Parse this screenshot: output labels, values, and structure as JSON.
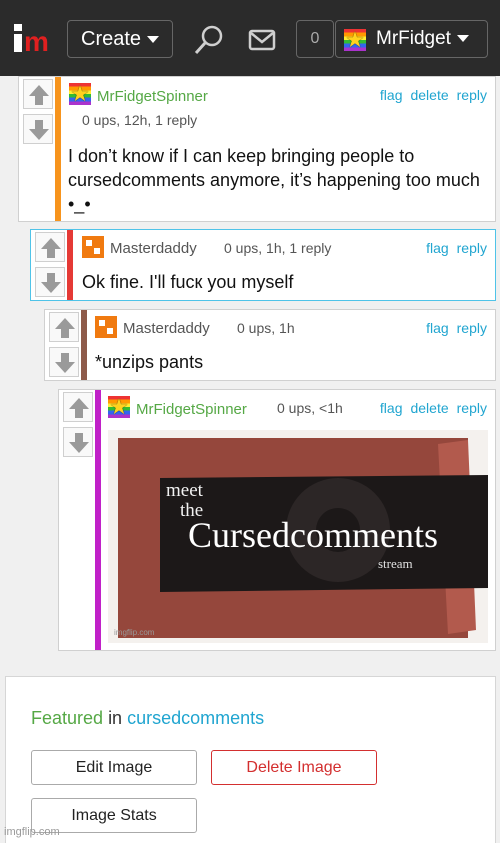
{
  "topbar": {
    "create_label": "Create",
    "notification_count": "0",
    "username": "MrFidget"
  },
  "comments": [
    {
      "username": "MrFidgetSpinner",
      "meta": "0 ups, 12h, 1 reply",
      "actions": [
        "flag",
        "delete",
        "reply"
      ],
      "text": "I don’t know if I can keep bringing people to cursedcomments anymore, it’s happening too much •_•",
      "bar_color": "#f7941d"
    },
    {
      "username": "Masterdaddy",
      "meta": "0 ups, 1h, 1 reply",
      "actions": [
        "flag",
        "reply"
      ],
      "text": "Ok fine. I'll fucк you myself",
      "bar_color": "#e53935"
    },
    {
      "username": "Masterdaddy",
      "meta": "0 ups, 1h",
      "actions": [
        "flag",
        "reply"
      ],
      "text": "*unzips pants",
      "bar_color": "#8d5a4a"
    },
    {
      "username": "MrFidgetSpinner",
      "meta": "0 ups, <1h",
      "actions": [
        "flag",
        "delete",
        "reply"
      ],
      "bar_color": "#c020c8",
      "image": {
        "line1": "meet",
        "line2": "the",
        "title": "Cursedcomments",
        "subtitle": "stream",
        "credit": "imgflip.com"
      }
    }
  ],
  "featured": {
    "label": "Featured",
    "in": "in",
    "stream": "cursedcomments",
    "edit_label": "Edit Image",
    "delete_label": "Delete Image",
    "stats_label": "Image Stats"
  },
  "watermark": "imgflip.com",
  "colors": {
    "topbar": "#2b2b2b",
    "username": "#55a845",
    "link": "#20a5d0",
    "delete": "#d32f2f"
  }
}
